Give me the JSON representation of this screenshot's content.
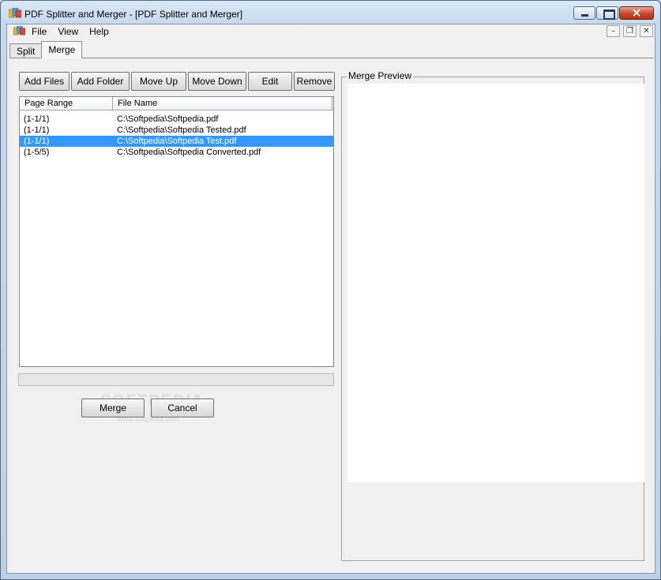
{
  "window": {
    "title": "PDF Splitter and  Merger - [PDF Splitter and Merger]"
  },
  "menu": {
    "items": [
      "File",
      "View",
      "Help"
    ]
  },
  "tabs": [
    {
      "label": "Split",
      "active": false
    },
    {
      "label": "Merge",
      "active": true
    }
  ],
  "toolbar": {
    "add_files": "Add Files",
    "add_folder": "Add Folder",
    "move_up": "Move Up",
    "move_down": "Move Down",
    "edit": "Edit",
    "remove": "Remove"
  },
  "file_list": {
    "columns": [
      "Page Range",
      "File Name"
    ],
    "rows": [
      {
        "page_range": "(1-1/1)",
        "file_name": "C:\\Softpedia\\Softpedia.pdf",
        "selected": false
      },
      {
        "page_range": "(1-1/1)",
        "file_name": "C:\\Softpedia\\Softpedia Tested.pdf",
        "selected": false
      },
      {
        "page_range": "(1-1/1)",
        "file_name": "C:\\Softpedia\\Softpedia Test.pdf",
        "selected": true
      },
      {
        "page_range": "(1-5/5)",
        "file_name": "C:\\Softpedia\\Softpedia Converted.pdf",
        "selected": false
      }
    ]
  },
  "progress": {
    "value": 0
  },
  "actions": {
    "merge": "Merge",
    "cancel": "Cancel"
  },
  "preview": {
    "label": "Merge Preview"
  },
  "watermark": {
    "text": "SOFTPEDIA",
    "sub": "www.softpedia.com"
  },
  "colors": {
    "selection": "#3399ff",
    "close_button": "#c7482e"
  }
}
